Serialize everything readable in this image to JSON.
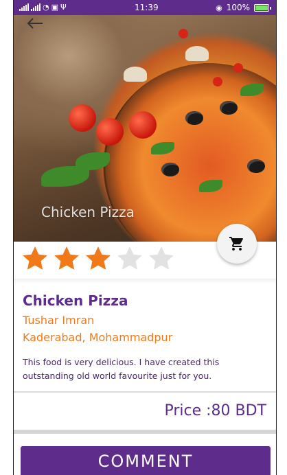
{
  "status_bar": {
    "time": "11:39",
    "battery": "100%",
    "icons": [
      "signal-icon",
      "wifi-icon",
      "notification-icon",
      "usb-icon",
      "eye-icon",
      "battery-icon"
    ]
  },
  "hero": {
    "caption": "Chicken Pizza",
    "back_icon": "arrow-back-icon"
  },
  "cart": {
    "icon": "shopping-cart-icon"
  },
  "rating": {
    "value": 3,
    "max": 5,
    "filled_color": "#f07a1a",
    "empty_color": "#e2e2e2"
  },
  "item": {
    "title": "Chicken Pizza",
    "author": "Tushar Imran",
    "address": "Kaderabad, Mohammadpur",
    "description": "This food is very delicious. I have created this outstanding old world favourite just for you.",
    "price": "Price :80 BDT"
  },
  "actions": {
    "comment_label": "COMMENT"
  },
  "colors": {
    "primary": "#5e2d8c",
    "accent": "#ef7a1a"
  }
}
